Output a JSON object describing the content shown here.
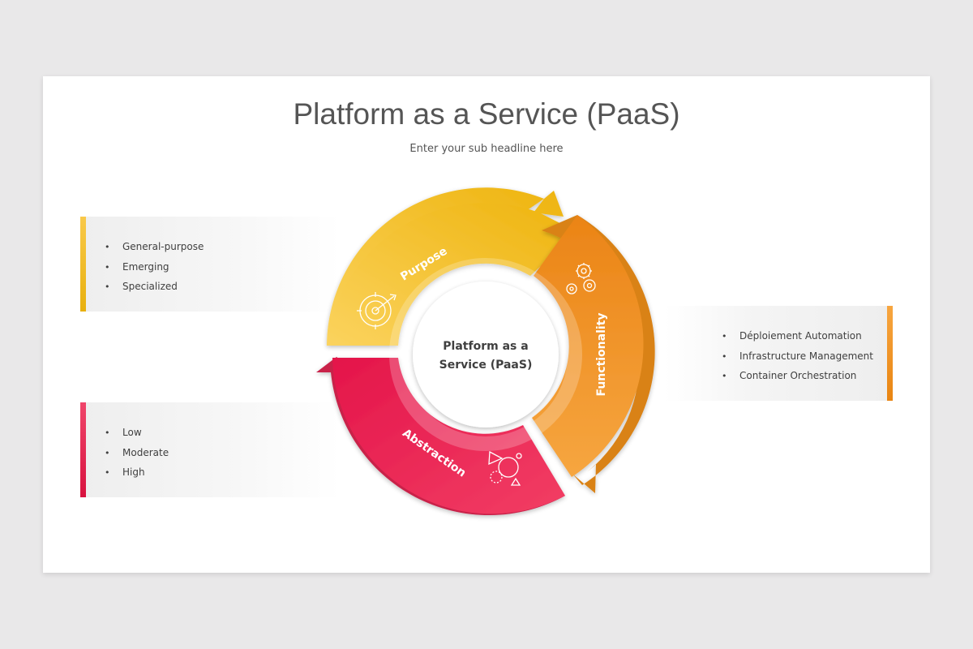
{
  "header": {
    "title": "Platform as a Service (PaaS)",
    "subtitle": "Enter your sub headline here"
  },
  "center": {
    "line1": "Platform as a",
    "line2": "Service (PaaS)"
  },
  "segments": {
    "purpose": {
      "label": "Purpose",
      "icon": "target-icon",
      "color": "#f2bb1e",
      "items": [
        "General-purpose",
        "Emerging",
        "Specialized"
      ]
    },
    "functionality": {
      "label": "Functionality",
      "icon": "gears-icon",
      "color": "#ee8a1a",
      "items": [
        "Déploiement Automation",
        "Infrastructure Management",
        "Container Orchestration"
      ]
    },
    "abstraction": {
      "label": "Abstraction",
      "icon": "shapes-icon",
      "color": "#e8234c",
      "items": [
        "Low",
        "Moderate",
        "High"
      ]
    }
  }
}
